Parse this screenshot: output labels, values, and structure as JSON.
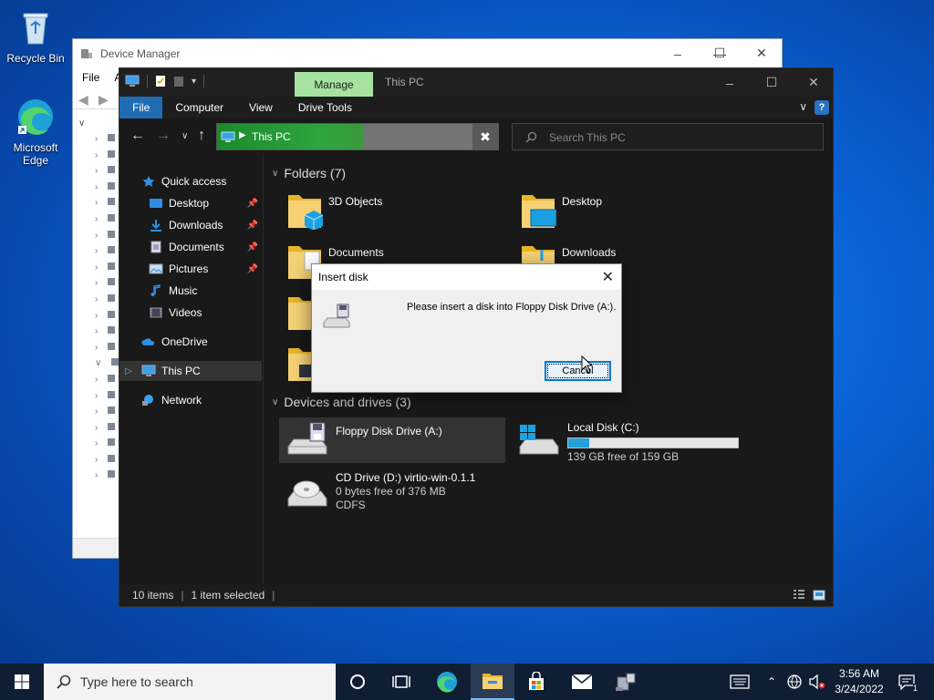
{
  "desktop": {
    "recycle_bin": "Recycle Bin",
    "edge": "Microsoft Edge"
  },
  "device_manager": {
    "title": "Device Manager",
    "menu_file": "File",
    "menu_a": "A"
  },
  "explorer": {
    "manage_tab": "Manage",
    "title": "This PC",
    "ribbon": {
      "file": "File",
      "computer": "Computer",
      "view": "View",
      "drive_tools": "Drive Tools",
      "help": "?"
    },
    "address": "This PC",
    "search_placeholder": "Search This PC",
    "sidebar": {
      "quick_access": "Quick access",
      "desktop": "Desktop",
      "downloads": "Downloads",
      "documents": "Documents",
      "pictures": "Pictures",
      "music": "Music",
      "videos": "Videos",
      "onedrive": "OneDrive",
      "this_pc": "This PC",
      "network": "Network"
    },
    "folders_header": "Folders (7)",
    "folders": [
      "3D Objects",
      "Desktop",
      "Documents",
      "Downloads"
    ],
    "drives_header": "Devices and drives (3)",
    "drives": [
      {
        "name": "Floppy Disk Drive (A:)"
      },
      {
        "name": "Local Disk (C:)",
        "free": "139 GB free of 159 GB",
        "used_fraction": 0.126
      },
      {
        "name": "CD Drive (D:) virtio-win-0.1.1",
        "free": "0 bytes free of 376 MB",
        "fs": "CDFS"
      }
    ],
    "status": {
      "items": "10 items",
      "selected": "1 item selected"
    }
  },
  "dialog": {
    "title": "Insert disk",
    "message": "Please insert a disk into Floppy Disk Drive (A:).",
    "cancel": "Cancel"
  },
  "taskbar": {
    "search_placeholder": "Type here to search",
    "time": "3:56 AM",
    "date": "3/24/2022",
    "notification_count": "1"
  }
}
